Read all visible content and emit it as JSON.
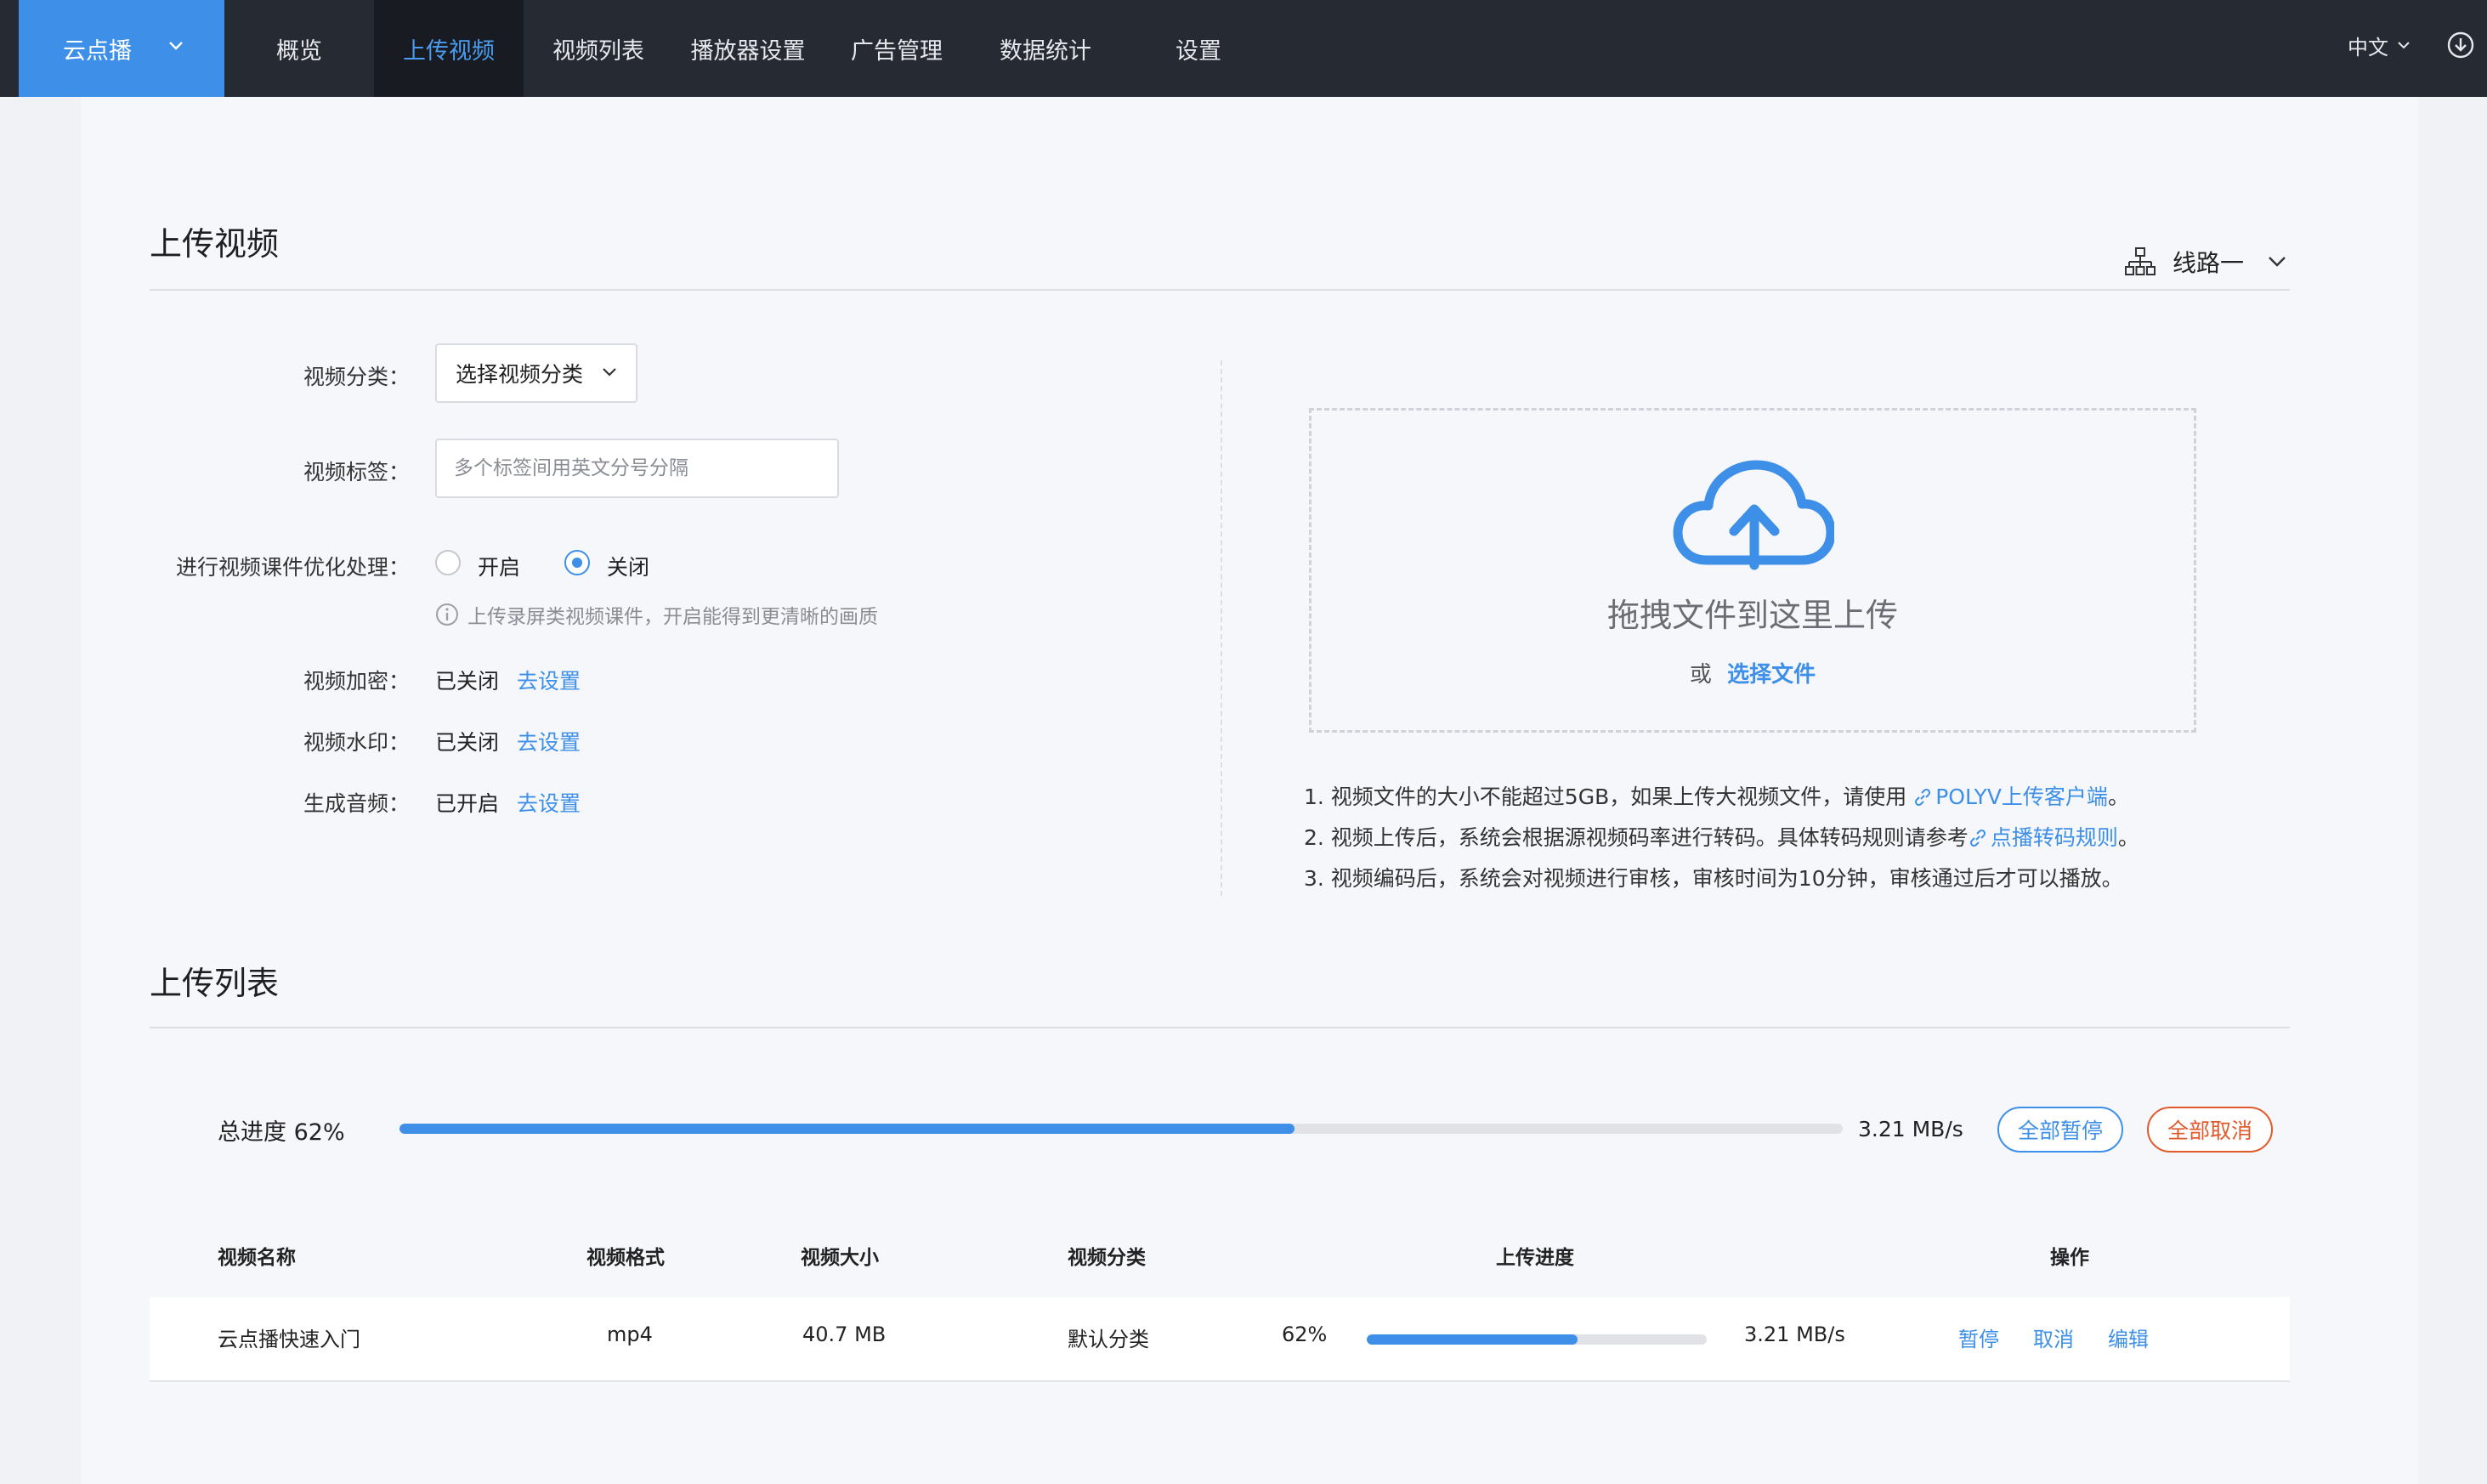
{
  "nav": {
    "brand": "云点播",
    "items": [
      "概览",
      "上传视频",
      "视频列表",
      "播放器设置",
      "广告管理",
      "数据统计",
      "设置"
    ],
    "active_index": 1,
    "language": "中文"
  },
  "upload": {
    "title": "上传视频",
    "route": "线路一",
    "form": {
      "category_label": "视频分类：",
      "category_value": "选择视频分类",
      "tags_label": "视频标签：",
      "tags_placeholder": "多个标签间用英文分号分隔",
      "optimize_label": "进行视频课件优化处理：",
      "optimize_on": "开启",
      "optimize_off": "关闭",
      "optimize_selected": "关闭",
      "optimize_hint": "上传录屏类视频课件，开启能得到更清晰的画质",
      "encrypt_label": "视频加密：",
      "encrypt_value": "已关闭",
      "watermark_label": "视频水印：",
      "watermark_value": "已关闭",
      "audio_label": "生成音频：",
      "audio_value": "已开启",
      "settings_link": "去设置"
    },
    "dropzone": {
      "title": "拖拽文件到这里上传",
      "or": "或",
      "choose": "选择文件"
    },
    "notes": [
      {
        "text": "1. 视频文件的大小不能超过5GB，如果上传大视频文件，请使用 ",
        "link": "POLYV上传客户端",
        "tail": "。"
      },
      {
        "text": "2. 视频上传后，系统会根据源视频码率进行转码。具体转码规则请参考",
        "link": "点播转码规则",
        "tail": "。"
      },
      {
        "text": "3. 视频编码后，系统会对视频进行审核，审核时间为10分钟，审核通过后才可以播放。",
        "link": "",
        "tail": ""
      }
    ]
  },
  "list": {
    "title": "上传列表",
    "total_label": "总进度 62%",
    "total_progress": 0.62,
    "total_speed": "3.21 MB/s",
    "pause_all": "全部暂停",
    "cancel_all": "全部取消",
    "columns": [
      "视频名称",
      "视频格式",
      "视频大小",
      "视频分类",
      "上传进度",
      "操作"
    ],
    "rows": [
      {
        "name": "云点播快速入门",
        "format": "mp4",
        "size": "40.7 MB",
        "category": "默认分类",
        "progress_text": "62%",
        "progress": 0.62,
        "speed": "3.21 MB/s",
        "actions": [
          "暂停",
          "取消",
          "编辑"
        ]
      }
    ]
  },
  "colors": {
    "accent": "#3d8fe7",
    "nav_bg": "#262b33",
    "danger": "#e25a2b"
  }
}
